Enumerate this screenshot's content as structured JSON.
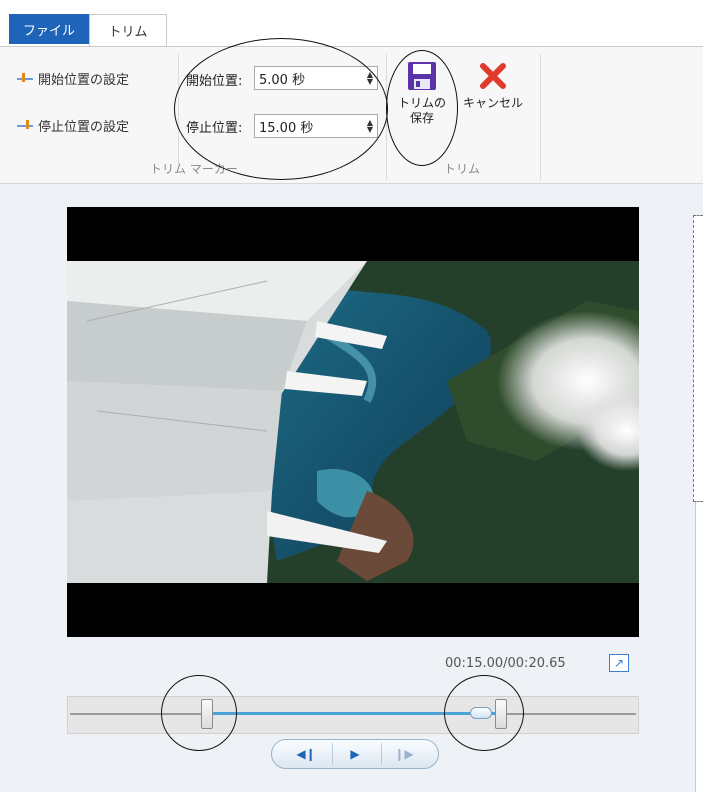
{
  "tabs": [
    {
      "label": "ファイル",
      "active": false
    },
    {
      "label": "トリム",
      "active": true
    }
  ],
  "ribbon": {
    "set_start_label": "開始位置の設定",
    "set_end_label": "停止位置の設定",
    "start_field": {
      "label": "開始位置:",
      "value": "5.00 秒"
    },
    "end_field": {
      "label": "停止位置:",
      "value": "15.00 秒"
    },
    "markers_group_label": "トリム マーカー",
    "save_label_line1": "トリムの",
    "save_label_line2": "保存",
    "cancel_label": "キャンセル",
    "trim_group_label": "トリム"
  },
  "player": {
    "timecode": "00:15.00/00:20.65",
    "trim_start_fraction": 0.242,
    "trim_end_fraction": 0.726,
    "playhead_fraction": 0.726
  },
  "icons": {
    "set_start": "marker-start-icon",
    "set_end": "marker-end-icon",
    "save": "floppy-disk-icon",
    "cancel": "red-x-icon",
    "expand": "expand-arrow-icon",
    "prev_frame": "previous-frame-icon",
    "play": "play-icon",
    "next_frame": "next-frame-icon"
  },
  "colors": {
    "accent": "#1e64b8",
    "selection": "#4aa3d8",
    "cancel_red": "#e03a2a"
  }
}
